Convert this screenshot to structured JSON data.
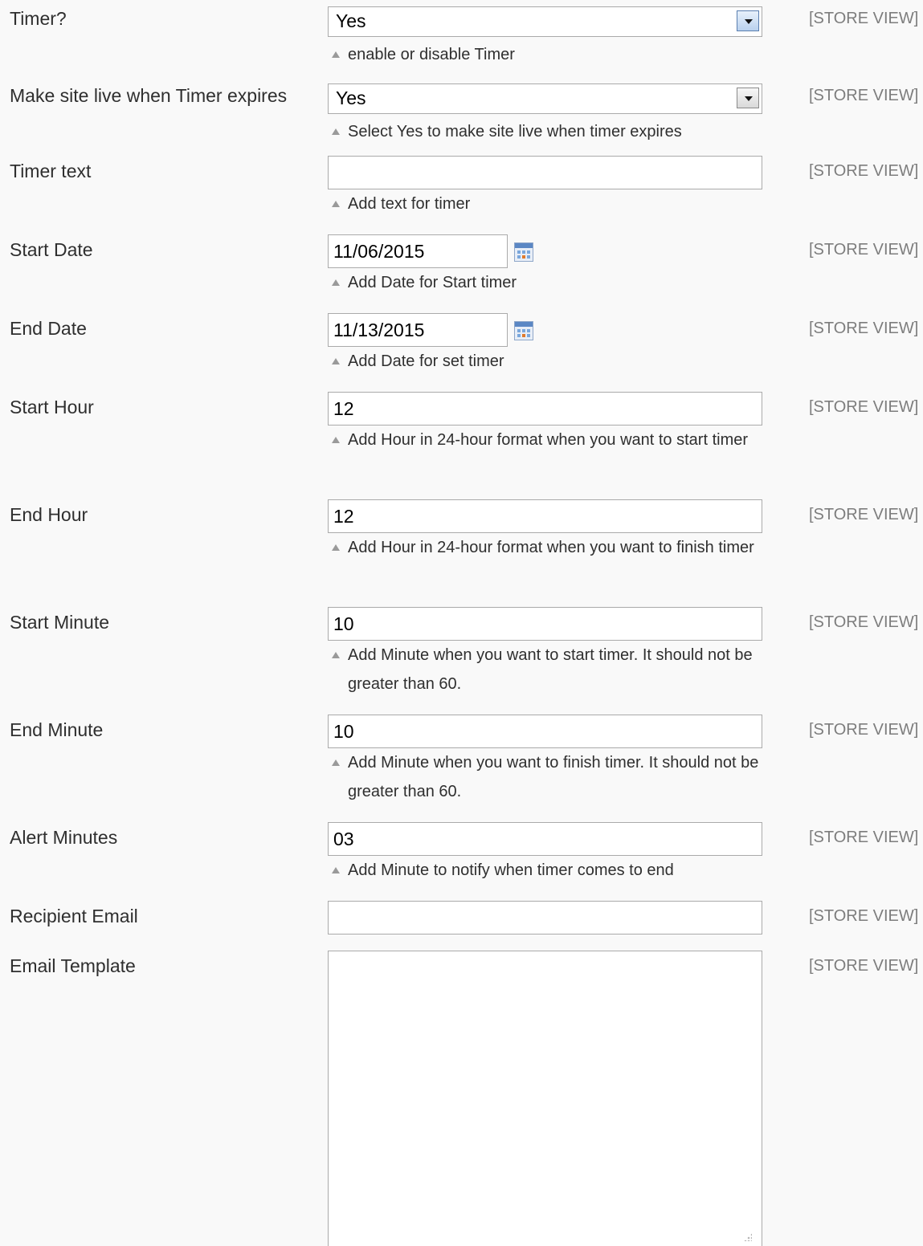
{
  "rows": [
    {
      "label": "Timer?",
      "value": "Yes",
      "note": "enable or disable Timer",
      "scope": "[STORE VIEW]"
    },
    {
      "label": "Make site live when Timer expires",
      "value": "Yes",
      "note": "Select Yes to make site live when timer expires",
      "scope": "[STORE VIEW]"
    },
    {
      "label": "Timer text",
      "value": "",
      "note": "Add text for timer",
      "scope": "[STORE VIEW]"
    },
    {
      "label": "Start Date",
      "value": "11/06/2015",
      "note": "Add Date for Start timer",
      "scope": "[STORE VIEW]",
      "icon": "calendar-icon"
    },
    {
      "label": "End Date",
      "value": "11/13/2015",
      "note": "Add Date for set timer",
      "scope": "[STORE VIEW]",
      "icon": "calendar-icon"
    },
    {
      "label": "Start Hour",
      "value": "12",
      "note": "Add Hour in 24-hour format when you want to start timer",
      "scope": "[STORE VIEW]"
    },
    {
      "label": "End Hour",
      "value": "12",
      "note": "Add Hour in 24-hour format when you want to finish timer",
      "scope": "[STORE VIEW]"
    },
    {
      "label": "Start Minute",
      "value": "10",
      "note": "Add Minute when you want to start timer. It should not be greater than 60.",
      "scope": "[STORE VIEW]"
    },
    {
      "label": "End Minute",
      "value": "10",
      "note": "Add Minute when you want to finish timer. It should not be greater than 60.",
      "scope": "[STORE VIEW]"
    },
    {
      "label": "Alert Minutes",
      "value": "03",
      "note": "Add Minute to notify when timer comes to end",
      "scope": "[STORE VIEW]"
    },
    {
      "label": "Recipient Email",
      "value": "",
      "scope": "[STORE VIEW]"
    },
    {
      "label": "Email Template",
      "value": "",
      "scope": "[STORE VIEW]"
    }
  ]
}
